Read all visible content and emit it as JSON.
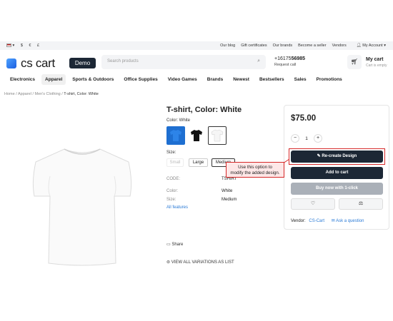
{
  "topbar": {
    "currency_usd": "$",
    "currency_eur": "€",
    "currency_gbp": "£",
    "links": [
      "Our blog",
      "Gift certificates",
      "Our brands",
      "Become a seller",
      "Vendors"
    ],
    "account": "My Account"
  },
  "header": {
    "logo_text": "cs cart",
    "demo_badge": "Demo",
    "search_placeholder": "Search products",
    "phone_prefix": "+16175",
    "phone_bold": "56985",
    "request_call": "Request call",
    "cart_title": "My cart",
    "cart_status": "Cart is empty"
  },
  "nav": {
    "items": [
      "Electronics",
      "Apparel",
      "Sports & Outdoors",
      "Office Supplies",
      "Video Games",
      "Brands",
      "Newest",
      "Bestsellers",
      "Sales",
      "Promotions"
    ],
    "active_index": 1
  },
  "breadcrumb": {
    "items": [
      "Home",
      "Apparel",
      "Men's Clothing"
    ],
    "current": "T-shirt, Color: White",
    "separator": "/"
  },
  "product": {
    "title": "T-shirt, Color: White",
    "color_label": "Color: White",
    "swatch_colors": [
      "#1e6fd1",
      "#111111",
      "#ffffff"
    ],
    "size_label": "Size:",
    "sizes": [
      "Small",
      "Large",
      "Medium"
    ],
    "code_label": "CODE:",
    "code_value": "TSHIRT",
    "color_field_label": "Color:",
    "color_field_value": "White",
    "size_field_label": "Size:",
    "size_field_value": "Medium",
    "features_link": "All features",
    "share_label": "Share",
    "variations_link": "VIEW ALL VARIATIONS AS LIST"
  },
  "purchase": {
    "price": "$75.00",
    "qty_minus": "−",
    "qty_value": "1",
    "qty_plus": "+",
    "recreate_label": "Re-create Design",
    "add_to_cart_label": "Add to cart",
    "buy_now_label": "Buy now with 1-click",
    "vendor_label": "Vendor:",
    "vendor_name": "CS-Cart",
    "ask_question": "Ask a question"
  },
  "tooltip": {
    "line1": "Use this option to",
    "line2": "modify the added design."
  },
  "colors": {
    "dark_button": "#1c2735",
    "highlight": "#d62828",
    "link": "#2a7ad6"
  }
}
